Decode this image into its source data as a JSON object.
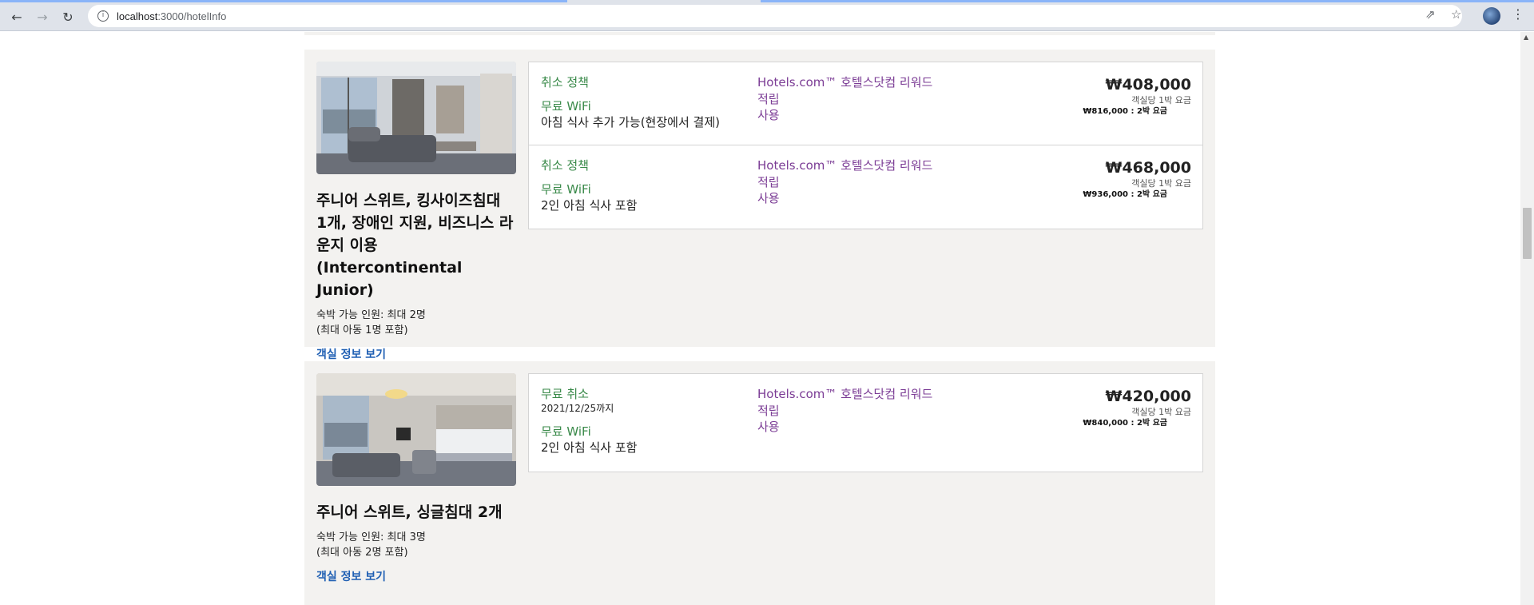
{
  "browser": {
    "url_host": "localhost",
    "url_path": ":3000/hotelInfo"
  },
  "rooms": [
    {
      "title": "주니어 스위트, 킹사이즈침대 1개, 장애인 지원, 비즈니스 라운지 이용 (Intercontinental Junior)",
      "occupancy_line1": "숙박 가능 인원: 최대 2명",
      "occupancy_line2": "(최대 아동 1명 포함)",
      "link": "객실 정보 보기",
      "rates": [
        {
          "cancel": "취소 정책",
          "cancel_date": "",
          "wifi": "무료 WiFi",
          "breakfast": "아침 식사 추가 가능(현장에서 결제)",
          "reward_line1": "Hotels.com™ 호텔스닷컴 리워드",
          "reward_line2": "적립",
          "reward_line3": "사용",
          "price": "₩408,000",
          "per_night": "객실당 1박 요금",
          "total": "₩816,000 : 2박 요금"
        },
        {
          "cancel": "취소 정책",
          "cancel_date": "",
          "wifi": "무료 WiFi",
          "breakfast": "2인 아침 식사 포함",
          "reward_line1": "Hotels.com™ 호텔스닷컴 리워드",
          "reward_line2": "적립",
          "reward_line3": "사용",
          "price": "₩468,000",
          "per_night": "객실당 1박 요금",
          "total": "₩936,000 : 2박 요금"
        }
      ]
    },
    {
      "title": "주니어 스위트, 싱글침대 2개",
      "occupancy_line1": "숙박 가능 인원: 최대 3명",
      "occupancy_line2": "(최대 아동 2명 포함)",
      "link": "객실 정보 보기",
      "rates": [
        {
          "cancel": "무료 취소",
          "cancel_date": "2021/12/25까지",
          "wifi": "무료 WiFi",
          "breakfast": "2인 아침 식사 포함",
          "reward_line1": "Hotels.com™ 호텔스닷컴 리워드",
          "reward_line2": "적립",
          "reward_line3": "사용",
          "price": "₩420,000",
          "per_night": "객실당 1박 요금",
          "total": "₩840,000 : 2박 요금"
        }
      ]
    }
  ]
}
